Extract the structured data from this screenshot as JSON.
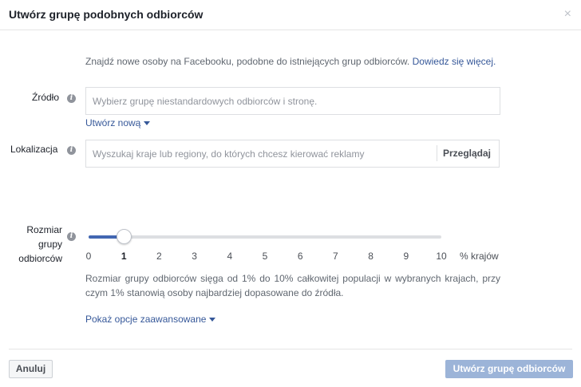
{
  "dialog": {
    "title": "Utwórz grupę podobnych odbiorców",
    "close_glyph": "×"
  },
  "intro": {
    "text": "Znajdź nowe osoby na Facebooku, podobne do istniejących grup odbiorców.",
    "link": "Dowiedz się więcej."
  },
  "source": {
    "label": "Źródło",
    "placeholder": "Wybierz grupę niestandardowych odbiorców i stronę.",
    "create_link": "Utwórz nową"
  },
  "location": {
    "label": "Lokalizacja",
    "placeholder": "Wyszukaj kraje lub regiony, do których chcesz kierować reklamy",
    "browse": "Przeglądaj"
  },
  "size": {
    "label_line1": "Rozmiar",
    "label_line2": "grupy",
    "label_line3": "odbiorców",
    "value": 1,
    "min": 0,
    "max": 10,
    "ticks": [
      "0",
      "1",
      "2",
      "3",
      "4",
      "5",
      "6",
      "7",
      "8",
      "9",
      "10"
    ],
    "unit": "% krajów",
    "description": "Rozmiar grupy odbiorców sięga od 1% do 10% całkowitej populacji w wybranych krajach, przy czym 1% stanowią osoby najbardziej dopasowane do źródła."
  },
  "advanced": {
    "label": "Pokaż opcje zaawansowane"
  },
  "footer": {
    "cancel": "Anuluj",
    "create": "Utwórz grupę odbiorców"
  },
  "info_glyph": "i",
  "colors": {
    "link": "#365899",
    "accent": "#4267b2",
    "primary_disabled": "#9cb4d8"
  }
}
